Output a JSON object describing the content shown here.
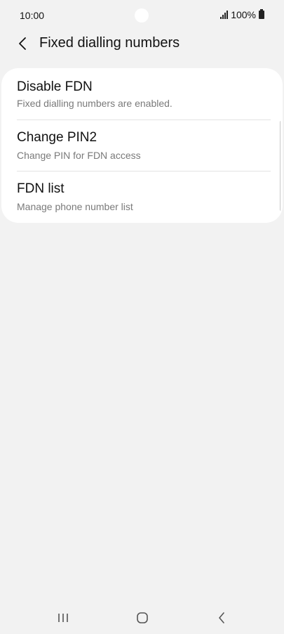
{
  "status_bar": {
    "time": "10:00",
    "battery": "100%"
  },
  "header": {
    "title": "Fixed dialling numbers"
  },
  "items": [
    {
      "title": "Disable FDN",
      "subtitle": "Fixed dialling numbers are enabled."
    },
    {
      "title": "Change PIN2",
      "subtitle": "Change PIN for FDN access"
    },
    {
      "title": "FDN list",
      "subtitle": "Manage phone number list"
    }
  ],
  "icons": {
    "back": "chevron-left-icon",
    "signal": "signal-icon",
    "battery": "battery-icon",
    "recents": "recents-icon",
    "home": "home-icon",
    "nav_back": "back-icon"
  }
}
